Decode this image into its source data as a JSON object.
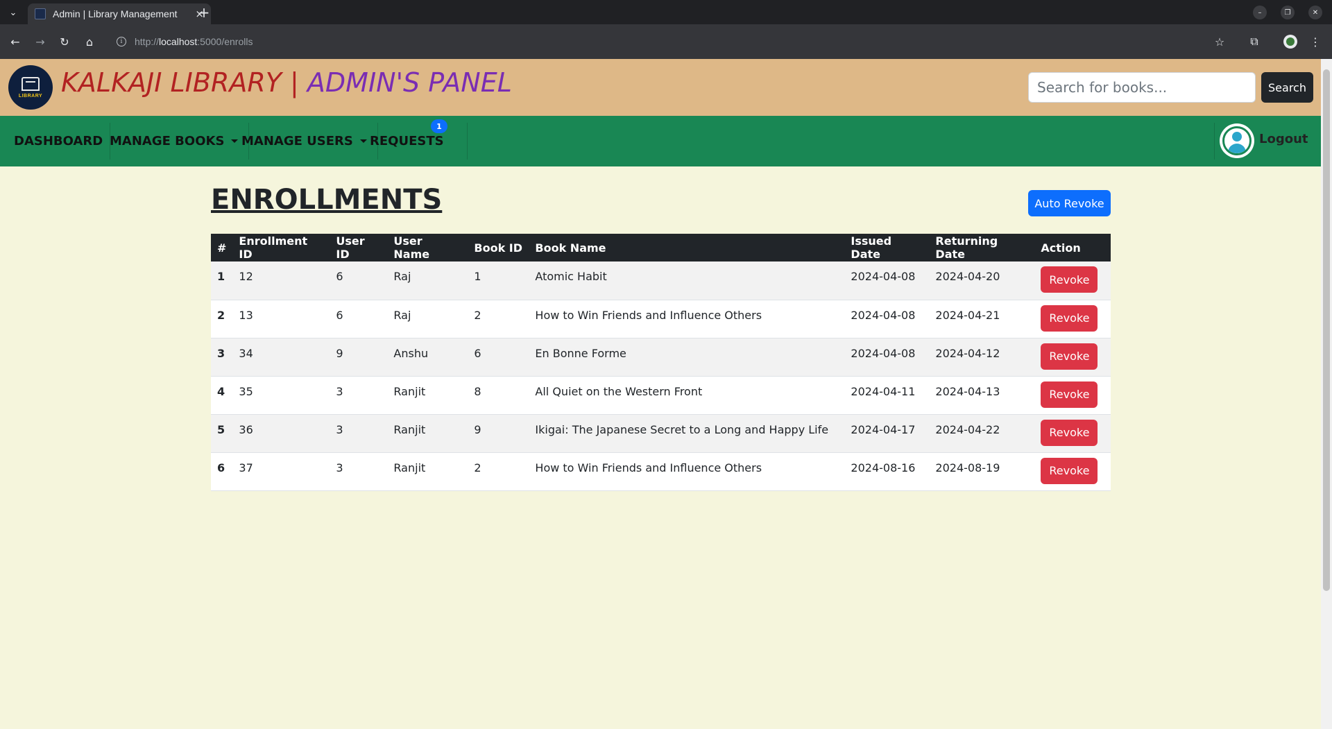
{
  "browser": {
    "tab_title": "Admin | Library Management",
    "url_prefix": "http://",
    "url_host": "localhost",
    "url_path": ":5000/enrolls",
    "icons": [
      "tab-list-icon",
      "close-icon",
      "new-tab-icon",
      "minimize-icon",
      "restore-icon",
      "window-close-icon",
      "back-icon",
      "forward-icon",
      "reload-icon",
      "home-icon",
      "info-icon",
      "star-icon",
      "extensions-icon",
      "profile-icon",
      "menu-icon"
    ]
  },
  "header": {
    "logo_text": "LIBRARY",
    "brand_part1": "KALKAJI LIBRARY |",
    "brand_part2": " ADMIN'S PANEL",
    "search_placeholder": "Search for books...",
    "search_button": "Search",
    "colors": {
      "header_bg": "#deb887",
      "brand_red": "#b22222",
      "brand_purple": "#7a2db3"
    }
  },
  "nav": {
    "items": [
      {
        "label": "DASHBOARD"
      },
      {
        "label": "MANAGE BOOKS",
        "dropdown": true
      },
      {
        "label": "MANAGE USERS",
        "dropdown": true
      },
      {
        "label": "REQUESTS"
      }
    ],
    "requests_badge": "1",
    "logout": "Logout",
    "colors": {
      "nav_bg": "#198754",
      "badge": "#0d6efd"
    }
  },
  "main": {
    "title": "ENROLLMENTS",
    "auto_revoke": "Auto Revoke",
    "columns": [
      "#",
      "Enrollment ID",
      "User ID",
      "User Name",
      "Book ID",
      "Book Name",
      "Issued Date",
      "Returning Date",
      "Action"
    ],
    "rows": [
      {
        "n": "1",
        "enroll_id": "12",
        "user_id": "6",
        "user": "Raj",
        "book_id": "1",
        "book": "Atomic Habit",
        "issued": "2024-04-08",
        "returning": "2024-04-20",
        "action": "Revoke"
      },
      {
        "n": "2",
        "enroll_id": "13",
        "user_id": "6",
        "user": "Raj",
        "book_id": "2",
        "book": "How to Win Friends and Influence Others",
        "issued": "2024-04-08",
        "returning": "2024-04-21",
        "action": "Revoke"
      },
      {
        "n": "3",
        "enroll_id": "34",
        "user_id": "9",
        "user": "Anshu",
        "book_id": "6",
        "book": "En Bonne Forme",
        "issued": "2024-04-08",
        "returning": "2024-04-12",
        "action": "Revoke"
      },
      {
        "n": "4",
        "enroll_id": "35",
        "user_id": "3",
        "user": "Ranjit",
        "book_id": "8",
        "book": "All Quiet on the Western Front",
        "issued": "2024-04-11",
        "returning": "2024-04-13",
        "action": "Revoke"
      },
      {
        "n": "5",
        "enroll_id": "36",
        "user_id": "3",
        "user": "Ranjit",
        "book_id": "9",
        "book": "Ikigai: The Japanese Secret to a Long and Happy Life",
        "issued": "2024-04-17",
        "returning": "2024-04-22",
        "action": "Revoke"
      },
      {
        "n": "6",
        "enroll_id": "37",
        "user_id": "3",
        "user": "Ranjit",
        "book_id": "2",
        "book": "How to Win Friends and Influence Others",
        "issued": "2024-08-16",
        "returning": "2024-08-19",
        "action": "Revoke"
      }
    ],
    "colors": {
      "page_bg": "#f5f5dc",
      "revoke": "#dc3545",
      "auto_revoke": "#0d6efd"
    }
  }
}
